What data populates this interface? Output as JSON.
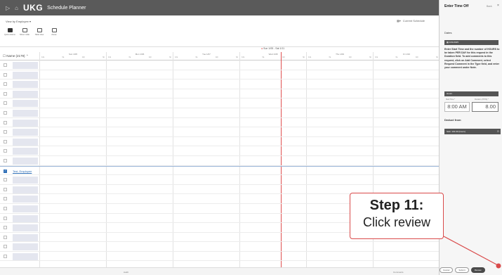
{
  "header": {
    "logo": "UKG",
    "app_title": "Schedule Planner",
    "nav_icons": [
      "play-icon",
      "home-icon"
    ]
  },
  "toolbar": {
    "view_by": "View by Employee ▾",
    "schedule_label": "Current Schedule",
    "tools": [
      {
        "label": "Quick Actions"
      },
      {
        "label": "Show / Hide"
      },
      {
        "label": "Table View"
      },
      {
        "label": "Zones"
      }
    ]
  },
  "grid": {
    "week_label": "Sun 1/05 - Sat 1/11",
    "name_header": "Name (2179)",
    "days": [
      {
        "label": "Sun 1/05"
      },
      {
        "label": "Mon 1/06"
      },
      {
        "label": "Tue 1/07"
      },
      {
        "label": "Wed 1/08"
      },
      {
        "label": "Thu 1/09"
      },
      {
        "label": "Fri 1/10"
      }
    ],
    "hours": [
      "12a",
      "6a",
      "12p",
      "6p"
    ],
    "selected_employee": "Test, Employee",
    "footer": {
      "left": "Audit",
      "right": "Comments"
    }
  },
  "panel": {
    "title": "Enter Time Off",
    "back": "Back",
    "close": "×",
    "dates_label": "Dates",
    "date_value": "1/01/2025",
    "instructions": "Enter Start Time and the number of HOURS to be taken PER DAY for this request in the Duration field. To add comments to this request, click on Add Comment, select Request Comment in the Type field, and enter your comment under Note.",
    "hours_section": "Hours",
    "start_label": "Start Time *",
    "duration_label": "Duration (HH:M) *",
    "start_time": "8:00 AM",
    "duration": "8.00",
    "deduct_label": "Deduct from",
    "deduct_value": "Sick: 101.00 (hours)",
    "buttons": {
      "cancel": "Cancel",
      "submit": "Submit",
      "review": "Review"
    }
  },
  "callout": {
    "line1": "Step 11:",
    "line2": "Click review",
    "accent": "#d94a4a"
  },
  "colors": {
    "header_bg": "#5a5a5a",
    "today_line": "#e05050",
    "selection": "#2f6fb7"
  }
}
